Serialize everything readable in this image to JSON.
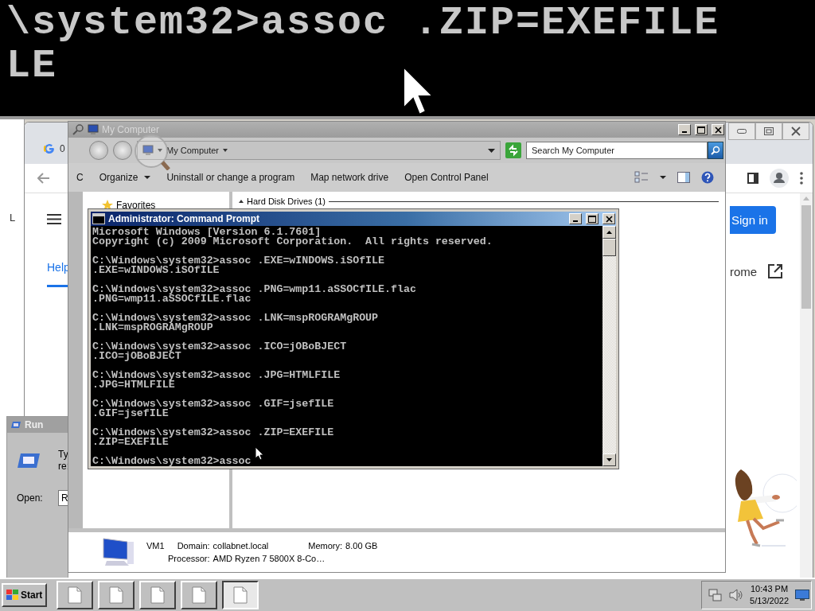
{
  "console_zoom": {
    "lines": [
      "\\system32>assoc .ZIP=EXEFILE",
      "LE"
    ]
  },
  "back_window": {
    "letter": "L"
  },
  "browser": {
    "tab_title": "0",
    "nav_link": {
      "label": "Help",
      "selected": true
    },
    "sign_in": "Sign in",
    "link_text": "rome"
  },
  "run_dialog": {
    "title": "Run",
    "description": [
      "Ty",
      "re:"
    ],
    "open_label": "Open:",
    "value": "R"
  },
  "my_computer": {
    "title": "My Computer",
    "breadcrumb": "My Computer",
    "search": {
      "placeholder": "Search My Computer"
    },
    "toolbar": [
      {
        "label": "C",
        "kind": "plain"
      },
      {
        "label": "Organize",
        "kind": "menu"
      },
      {
        "label": "Uninstall or change a program",
        "kind": "plain"
      },
      {
        "label": "Map network drive",
        "kind": "plain"
      },
      {
        "label": "Open Control Panel",
        "kind": "plain"
      }
    ],
    "nav": [
      {
        "label": "Favorites"
      }
    ],
    "group": {
      "label": "Hard Disk Drives (1)",
      "expanded": true
    },
    "details": {
      "name": "VM1",
      "domain_label": "Domain:",
      "domain": "collabnet.local",
      "memory_label": "Memory:",
      "memory": "8.00 GB",
      "processor_label": "Processor:",
      "processor": "AMD Ryzen 7 5800X 8-Co…"
    }
  },
  "cmd": {
    "title": "Administrator: Command Prompt",
    "blocks": [
      [
        "Microsoft Windows [Version 6.1.7601]",
        "Copyright (c) 2009 Microsoft Corporation.  All rights reserved."
      ],
      [
        "C:\\Windows\\system32>assoc .EXE=wINDOWS.iSOfILE",
        ".EXE=wINDOWS.iSOfILE"
      ],
      [
        "C:\\Windows\\system32>assoc .PNG=wmp11.aSSOCfILE.flac",
        ".PNG=wmp11.aSSOCfILE.flac"
      ],
      [
        "C:\\Windows\\system32>assoc .LNK=mspROGRAMgROUP",
        ".LNK=mspROGRAMgROUP"
      ],
      [
        "C:\\Windows\\system32>assoc .ICO=jOBoBJECT",
        ".ICO=jOBoBJECT"
      ],
      [
        "C:\\Windows\\system32>assoc .JPG=HTMLFILE",
        ".JPG=HTMLFILE"
      ],
      [
        "C:\\Windows\\system32>assoc .GIF=jsefILE",
        ".GIF=jsefILE"
      ],
      [
        "C:\\Windows\\system32>assoc .ZIP=EXEFILE",
        ".ZIP=EXEFILE"
      ],
      [
        "C:\\Windows\\system32>assoc"
      ]
    ]
  },
  "taskbar": {
    "start": "Start",
    "buttons": [
      {
        "selected": false
      },
      {
        "selected": false
      },
      {
        "selected": false
      },
      {
        "selected": false
      },
      {
        "selected": true
      }
    ],
    "time": "10:43 PM",
    "date": "5/13/2022"
  }
}
